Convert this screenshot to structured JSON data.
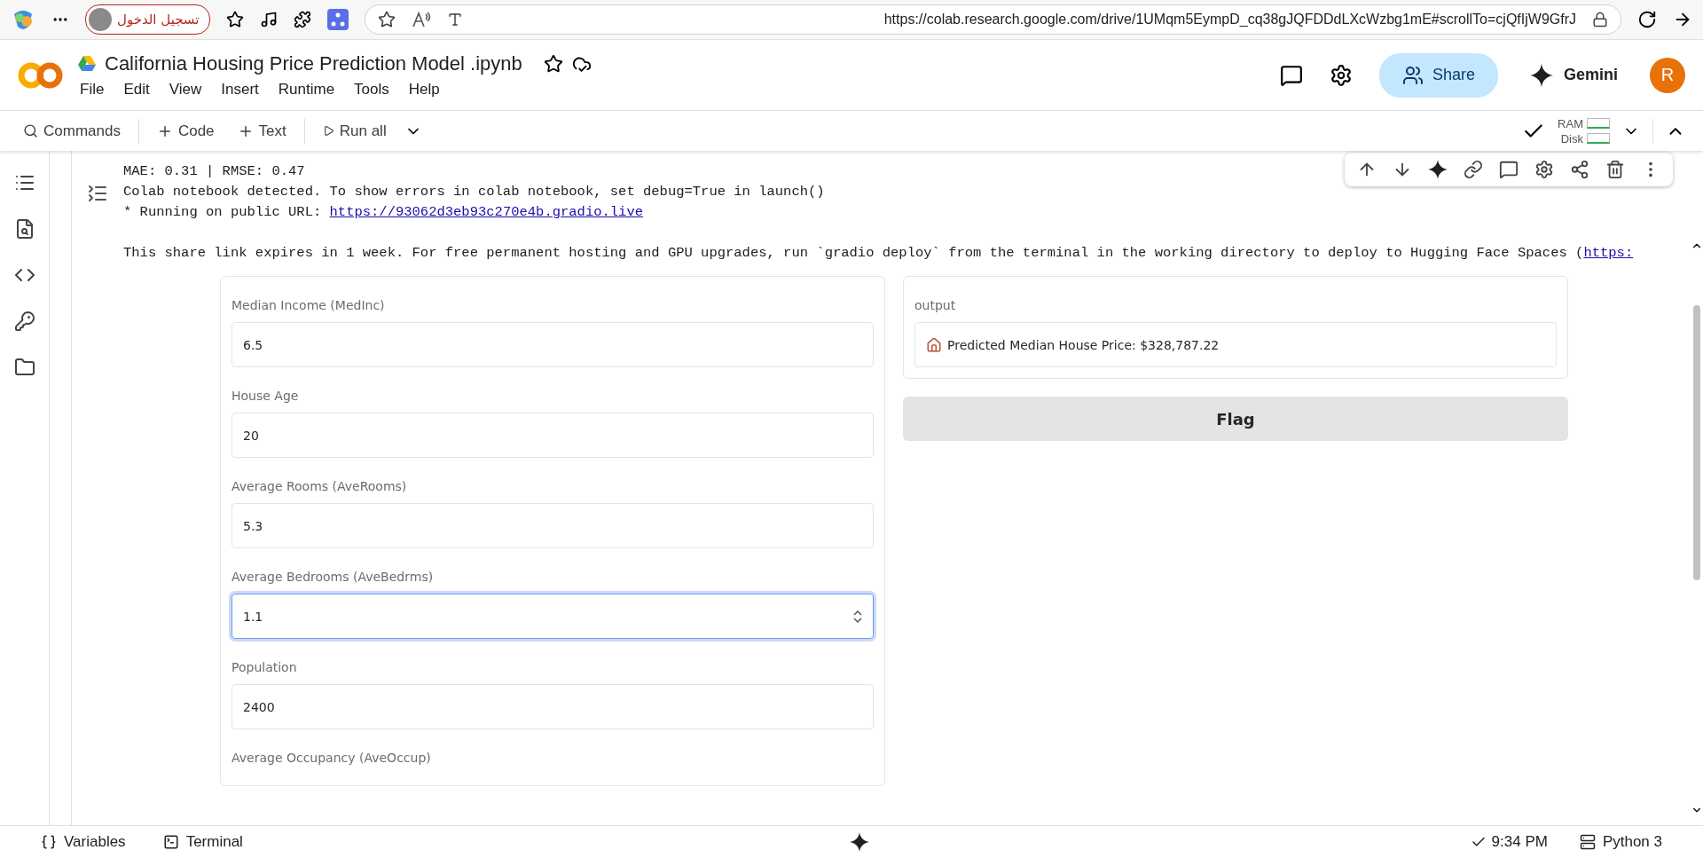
{
  "browser": {
    "profile_label": "تسجيل الدخول",
    "url": "https://colab.research.google.com/drive/1UMqm5EympD_cq38gJQFDDdLXcWzbg1mE#scrollTo=cjQfIjW9GfrJ"
  },
  "notebook": {
    "title": "California Housing Price Prediction Model .ipynb",
    "menu": [
      "File",
      "Edit",
      "View",
      "Insert",
      "Runtime",
      "Tools",
      "Help"
    ],
    "share": "Share",
    "gemini": "Gemini",
    "avatar": "R"
  },
  "toolbar": {
    "commands": "Commands",
    "add_code": "Code",
    "add_text": "Text",
    "run_all": "Run all",
    "ram": "RAM",
    "disk": "Disk"
  },
  "output": {
    "lines": [
      {
        "kind": "text",
        "text": "MAE: 0.31 | RMSE: 0.47"
      },
      {
        "kind": "text",
        "text": "Colab notebook detected. To show errors in colab notebook, set debug=True in launch()"
      },
      {
        "kind": "link",
        "text": "* Running on public URL: ",
        "link": "https://93062d3eb93c270e4b.gradio.live"
      },
      {
        "kind": "blank"
      },
      {
        "kind": "link",
        "text": "This share link expires in 1 week. For free permanent hosting and GPU upgrades, run `gradio deploy` from the terminal in the working directory to deploy to Hugging Face Spaces (",
        "link": "https:"
      }
    ]
  },
  "gradio": {
    "fields": [
      {
        "label": "Median Income (MedInc)",
        "value": "6.5",
        "focused": false
      },
      {
        "label": "House Age",
        "value": "20",
        "focused": false
      },
      {
        "label": "Average Rooms (AveRooms)",
        "value": "5.3",
        "focused": false
      },
      {
        "label": "Average Bedrooms (AveBedrms)",
        "value": "1.1",
        "focused": true
      },
      {
        "label": "Population",
        "value": "2400",
        "focused": false
      },
      {
        "label": "Average Occupancy (AveOccup)"
      }
    ],
    "output_label": "output",
    "output_value": "Predicted Median House Price: $328,787.22",
    "flag": "Flag"
  },
  "status_bar": {
    "variables": "Variables",
    "terminal": "Terminal",
    "time": "9:34 PM",
    "runtime": "Python 3"
  }
}
